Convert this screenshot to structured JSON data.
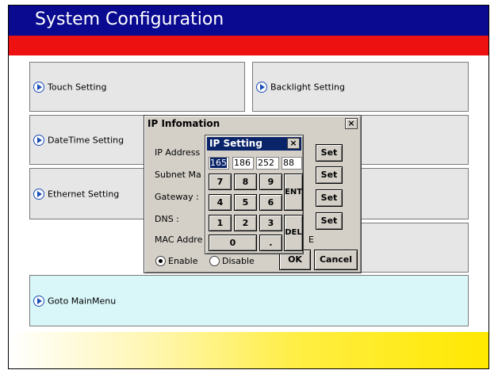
{
  "header": {
    "title": "System Configuration"
  },
  "tiles": {
    "touch": "Touch Setting",
    "backlight": "Backlight Setting",
    "datetime": "DateTime Setting",
    "ethernet": "Ethernet Setting",
    "goto_main": "Goto MainMenu"
  },
  "ip_info_dialog": {
    "title": "IP Infomation",
    "close_label": "×",
    "ip_address_label": "IP Address",
    "subnet_label": "Subnet Ma",
    "gateway_label": "Gateway :",
    "dns_label": "DNS :",
    "mac_label": "MAC Addre",
    "mac_trailing": "E",
    "set_label": "Set",
    "enable_label": "Enable",
    "disable_label": "Disable",
    "ok_label": "OK",
    "cancel_label": "Cancel",
    "enable_selected": true
  },
  "ip_setting_keypad": {
    "title": "IP Setting",
    "close_label": "×",
    "octets": [
      "165",
      "186",
      "252",
      "88"
    ],
    "keys": {
      "k7": "7",
      "k8": "8",
      "k9": "9",
      "k4": "4",
      "k5": "5",
      "k6": "6",
      "k1": "1",
      "k2": "2",
      "k3": "3",
      "k0": "0",
      "dot": ".",
      "ent": "ENT",
      "del": "DEL"
    }
  },
  "colors": {
    "title_bg": "#0a0a90",
    "red_band": "#ee1111",
    "tile_bg": "#e6e6e6",
    "main_menu_bg": "#d9f7f9",
    "yellow_band": "#ffe800",
    "keypad_title_bg": "#0a246a"
  },
  "icons": {
    "tile_arrow": "circle-arrow-right-icon"
  }
}
